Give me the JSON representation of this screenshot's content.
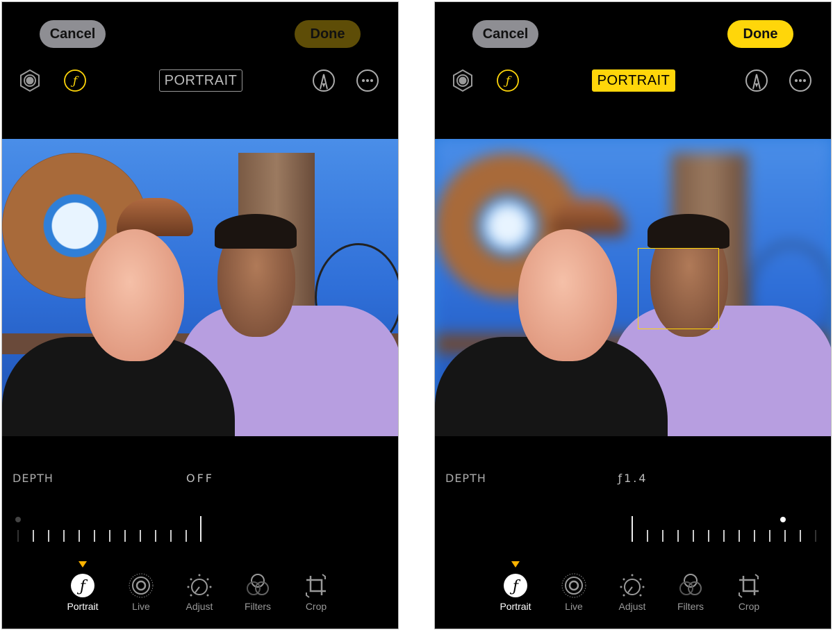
{
  "panels": [
    {
      "cancel_label": "Cancel",
      "done_label": "Done",
      "done_enabled": false,
      "portrait_badge": "PORTRAIT",
      "portrait_active": false,
      "depth_label": "DEPTH",
      "depth_value": "OFF",
      "slider_position": "off",
      "tools": [
        "Portrait",
        "Live",
        "Adjust",
        "Filters",
        "Crop"
      ],
      "active_tool": "Portrait"
    },
    {
      "cancel_label": "Cancel",
      "done_label": "Done",
      "done_enabled": true,
      "portrait_badge": "PORTRAIT",
      "portrait_active": true,
      "depth_label": "DEPTH",
      "depth_value": "ƒ1.4",
      "slider_position": "f1.4",
      "tools": [
        "Portrait",
        "Live",
        "Adjust",
        "Filters",
        "Crop"
      ],
      "active_tool": "Portrait",
      "face_focus_box": true
    }
  ],
  "icons": [
    "live-photo-hexagon-icon",
    "aperture-f-icon",
    "markup-pen-icon",
    "more-ellipsis-icon",
    "portrait-f-icon",
    "live-icon",
    "adjust-dial-icon",
    "filters-circles-icon",
    "crop-rotate-icon"
  ],
  "colors": {
    "accent_yellow": "#ffd60a",
    "done_disabled": "#5e4d07",
    "cancel_gray": "#8e8e93",
    "background": "#000000"
  }
}
